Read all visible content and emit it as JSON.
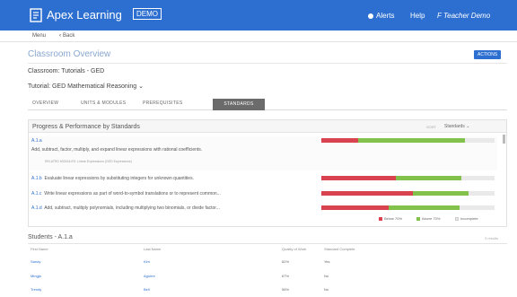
{
  "header": {
    "brand": "Apex Learning",
    "demo_badge": "DEMO",
    "alerts": "Alerts",
    "help": "Help",
    "user": "F Teacher Demo"
  },
  "subnav": {
    "menu": "Menu",
    "back": "Back"
  },
  "page": {
    "title": "Classroom Overview",
    "actions": "ACTIONS",
    "classroom": "Classroom: Tutorials - GED",
    "tutorial": "Tutorial: GED Mathematical Reasoning"
  },
  "tabs": [
    {
      "label": "OVERVIEW"
    },
    {
      "label": "UNITS & MODULES"
    },
    {
      "label": "PREREQUISITES"
    },
    {
      "label": "STANDARDS"
    }
  ],
  "panel": {
    "title": "Progress & Performance by Standards",
    "sort_label": "SORT",
    "sort_value": "Standards"
  },
  "standards": [
    {
      "code": "A.1.a",
      "description": "Add, subtract, factor, multiply, and expand linear expressions with rational coefficients.",
      "sub": "RELATED MODULES: Linear Expressions (GED Expressions)",
      "below": 0.21,
      "at_above": 0.62
    },
    {
      "code": "A.1.b",
      "description": "Evaluate linear expressions by substituting integers for unknown quantities.",
      "below": 0.43,
      "at_above": 0.38
    },
    {
      "code": "A.1.c",
      "description": "Write linear expressions as part of word-to-symbol translations or to represent common...",
      "below": 0.53,
      "at_above": 0.32
    },
    {
      "code": "A.1.d",
      "description": "Add, subtract, multiply polynomials, including multiplying two binomials, or divide factor...",
      "below": 0.39,
      "at_above": 0.41
    }
  ],
  "legend": {
    "below": "Below 70%",
    "at_above": "Above 70%",
    "incomplete": "Incomplete"
  },
  "colors": {
    "below": "#d9434f",
    "at_above": "#82c14b",
    "incomplete": "#e9e9e9",
    "primary": "#2d6fd0"
  },
  "students": {
    "title": "Students - A.1.a",
    "right_label": "3 results",
    "columns": [
      "First Name",
      "Last Name",
      "Quality of Work",
      "Standard Complete"
    ],
    "rows": [
      [
        "Sandy",
        "Kim",
        "82%",
        "Yes"
      ],
      [
        "Mingja",
        "Aguirre",
        "67%",
        "No"
      ],
      [
        "Trendy",
        "Bell",
        "56%",
        "No"
      ]
    ]
  }
}
